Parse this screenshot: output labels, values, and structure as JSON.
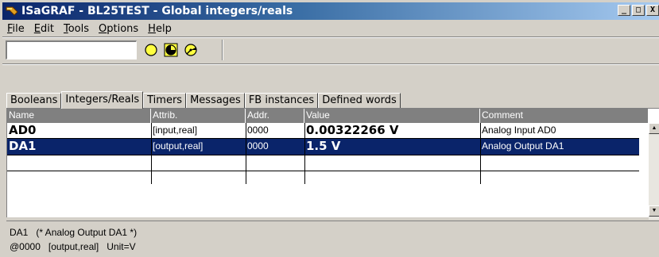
{
  "window": {
    "title": "ISaGRAF - BL25TEST - Global integers/reals",
    "buttons": [
      "_",
      "□",
      "X"
    ]
  },
  "menu": [
    {
      "label": "File",
      "accel": "F",
      "rest": "ile"
    },
    {
      "label": "Edit",
      "accel": "E",
      "rest": "dit"
    },
    {
      "label": "Tools",
      "accel": "T",
      "rest": "ools"
    },
    {
      "label": "Options",
      "accel": "O",
      "rest": "ptions"
    },
    {
      "label": "Help",
      "accel": "H",
      "rest": "elp"
    }
  ],
  "toolbar": {
    "input_value": "",
    "icons": [
      "yellow-circle-icon",
      "dial-icon",
      "gauge-icon"
    ]
  },
  "tabs": [
    "Booleans",
    "Integers/Reals",
    "Timers",
    "Messages",
    "FB instances",
    "Defined words"
  ],
  "active_tab": "Integers/Reals",
  "columns": [
    "Name",
    "Attrib.",
    "Addr.",
    "Value",
    "Comment"
  ],
  "rows": [
    {
      "name": "AD0",
      "attrib": "[input,real]",
      "addr": "0000",
      "value": "0.00322266 V",
      "comment": "Analog Input AD0",
      "selected": false
    },
    {
      "name": "DA1",
      "attrib": "[output,real]",
      "addr": "0000",
      "value": "1.5 V",
      "comment": "Analog Output DA1",
      "selected": true
    }
  ],
  "status": {
    "line1": "DA1   (* Analog Output DA1 *)",
    "line2": "@0000   [output,real]   Unit=V"
  },
  "colors": {
    "titlebar_start": "#0a246a",
    "selection": "#0a246a",
    "header_bg": "#808080"
  }
}
